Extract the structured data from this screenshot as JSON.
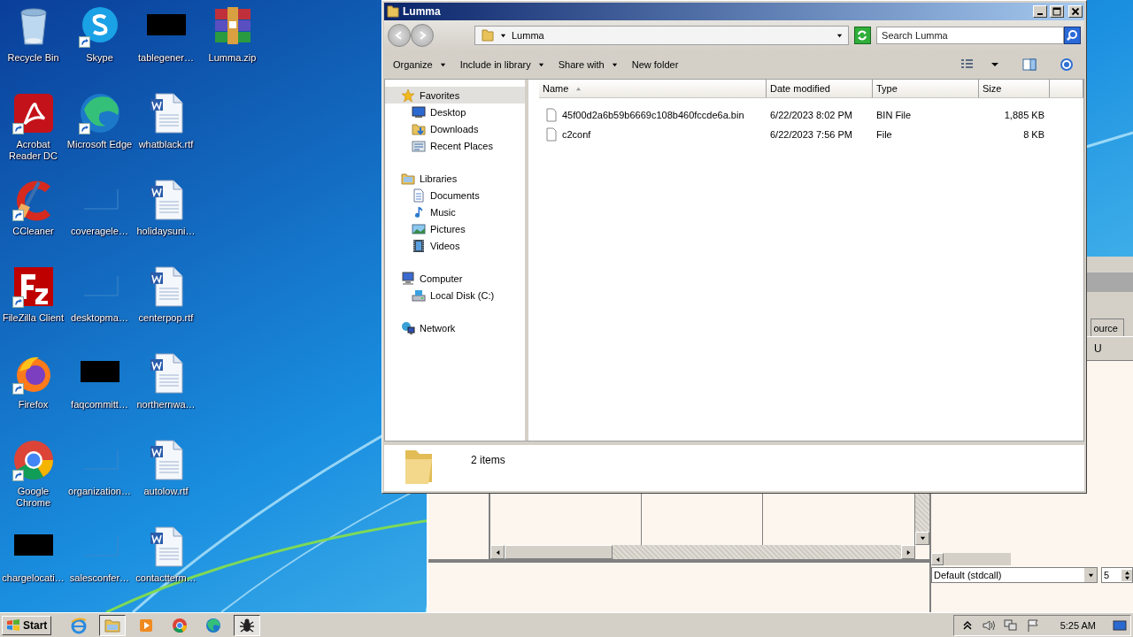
{
  "desktop": {
    "icons": [
      {
        "label": "Recycle Bin",
        "kind": "bin",
        "shortcut": false
      },
      {
        "label": "Acrobat Reader DC",
        "kind": "acrobat",
        "shortcut": true
      },
      {
        "label": "CCleaner",
        "kind": "ccleaner",
        "shortcut": true
      },
      {
        "label": "FileZilla Client",
        "kind": "filezilla",
        "shortcut": true
      },
      {
        "label": "Firefox",
        "kind": "firefox",
        "shortcut": true
      },
      {
        "label": "Google Chrome",
        "kind": "chrome",
        "shortcut": true
      },
      {
        "label": "chargelocati…",
        "kind": "black",
        "shortcut": false
      },
      {
        "label": "Skype",
        "kind": "skype",
        "shortcut": true
      },
      {
        "label": "Microsoft Edge",
        "kind": "edge",
        "shortcut": true
      },
      {
        "label": "coveragele…",
        "kind": "blank",
        "shortcut": false
      },
      {
        "label": "desktopma…",
        "kind": "blank",
        "shortcut": false
      },
      {
        "label": "faqcommitt…",
        "kind": "black",
        "shortcut": false
      },
      {
        "label": "organization…",
        "kind": "blank",
        "shortcut": false
      },
      {
        "label": "salesconfer…",
        "kind": "blank",
        "shortcut": false
      },
      {
        "label": "tablegener…",
        "kind": "black",
        "shortcut": false
      },
      {
        "label": "whatblack.rtf",
        "kind": "word",
        "shortcut": false
      },
      {
        "label": "holidaysuni…",
        "kind": "word",
        "shortcut": false
      },
      {
        "label": "centerpop.rtf",
        "kind": "word",
        "shortcut": false
      },
      {
        "label": "northernwa…",
        "kind": "word",
        "shortcut": false
      },
      {
        "label": "autolow.rtf",
        "kind": "word",
        "shortcut": false
      },
      {
        "label": "contactterm…",
        "kind": "word",
        "shortcut": false
      },
      {
        "label": "Lumma.zip",
        "kind": "zip",
        "shortcut": false
      }
    ]
  },
  "debugger": {
    "tab": "ource",
    "label": "U",
    "convention": "Default (stdcall)",
    "spin": "5"
  },
  "explorer": {
    "title": "Lumma",
    "address": "Lumma",
    "search": {
      "placeholder": "Search Lumma"
    },
    "toolbar": [
      {
        "label": "Organize",
        "menu": true
      },
      {
        "label": "Include in library",
        "menu": true
      },
      {
        "label": "Share with",
        "menu": true
      },
      {
        "label": "New folder",
        "menu": false
      }
    ],
    "nav": [
      {
        "label": "Favorites",
        "kind": "star",
        "selected": true,
        "children": [
          {
            "label": "Desktop",
            "kind": "desktop",
            "selected": false
          },
          {
            "label": "Downloads",
            "kind": "downloads",
            "selected": false
          },
          {
            "label": "Recent Places",
            "kind": "recent",
            "selected": false
          }
        ]
      },
      {
        "label": "Libraries",
        "kind": "library",
        "selected": false,
        "children": [
          {
            "label": "Documents",
            "kind": "documents",
            "selected": false
          },
          {
            "label": "Music",
            "kind": "music",
            "selected": false
          },
          {
            "label": "Pictures",
            "kind": "pictures",
            "selected": false
          },
          {
            "label": "Videos",
            "kind": "videos",
            "selected": false
          }
        ]
      },
      {
        "label": "Computer",
        "kind": "computer",
        "selected": false,
        "children": [
          {
            "label": "Local Disk (C:)",
            "kind": "disk",
            "selected": false
          }
        ]
      },
      {
        "label": "Network",
        "kind": "network",
        "selected": false
      }
    ],
    "columns": [
      {
        "label": "Name",
        "sorted": true
      },
      {
        "label": "Date modified",
        "sorted": false
      },
      {
        "label": "Type",
        "sorted": false
      },
      {
        "label": "Size",
        "sorted": false
      }
    ],
    "files": [
      {
        "name": "45f00d2a6b59b6669c108b460fccde6a.bin",
        "date": "6/22/2023 8:02 PM",
        "type": "BIN File",
        "size": "1,885 KB"
      },
      {
        "name": "c2conf",
        "date": "6/22/2023 7:56 PM",
        "type": "File",
        "size": "8 KB"
      }
    ],
    "status": "2 items"
  },
  "taskbar": {
    "start": "Start",
    "apps": [
      {
        "kind": "ie",
        "active": false
      },
      {
        "kind": "explorer",
        "active": true
      },
      {
        "kind": "media",
        "active": false
      },
      {
        "kind": "chrome",
        "active": false
      },
      {
        "kind": "edge",
        "active": false
      },
      {
        "kind": "bug",
        "active": true
      }
    ],
    "clock": "5:25 AM"
  }
}
